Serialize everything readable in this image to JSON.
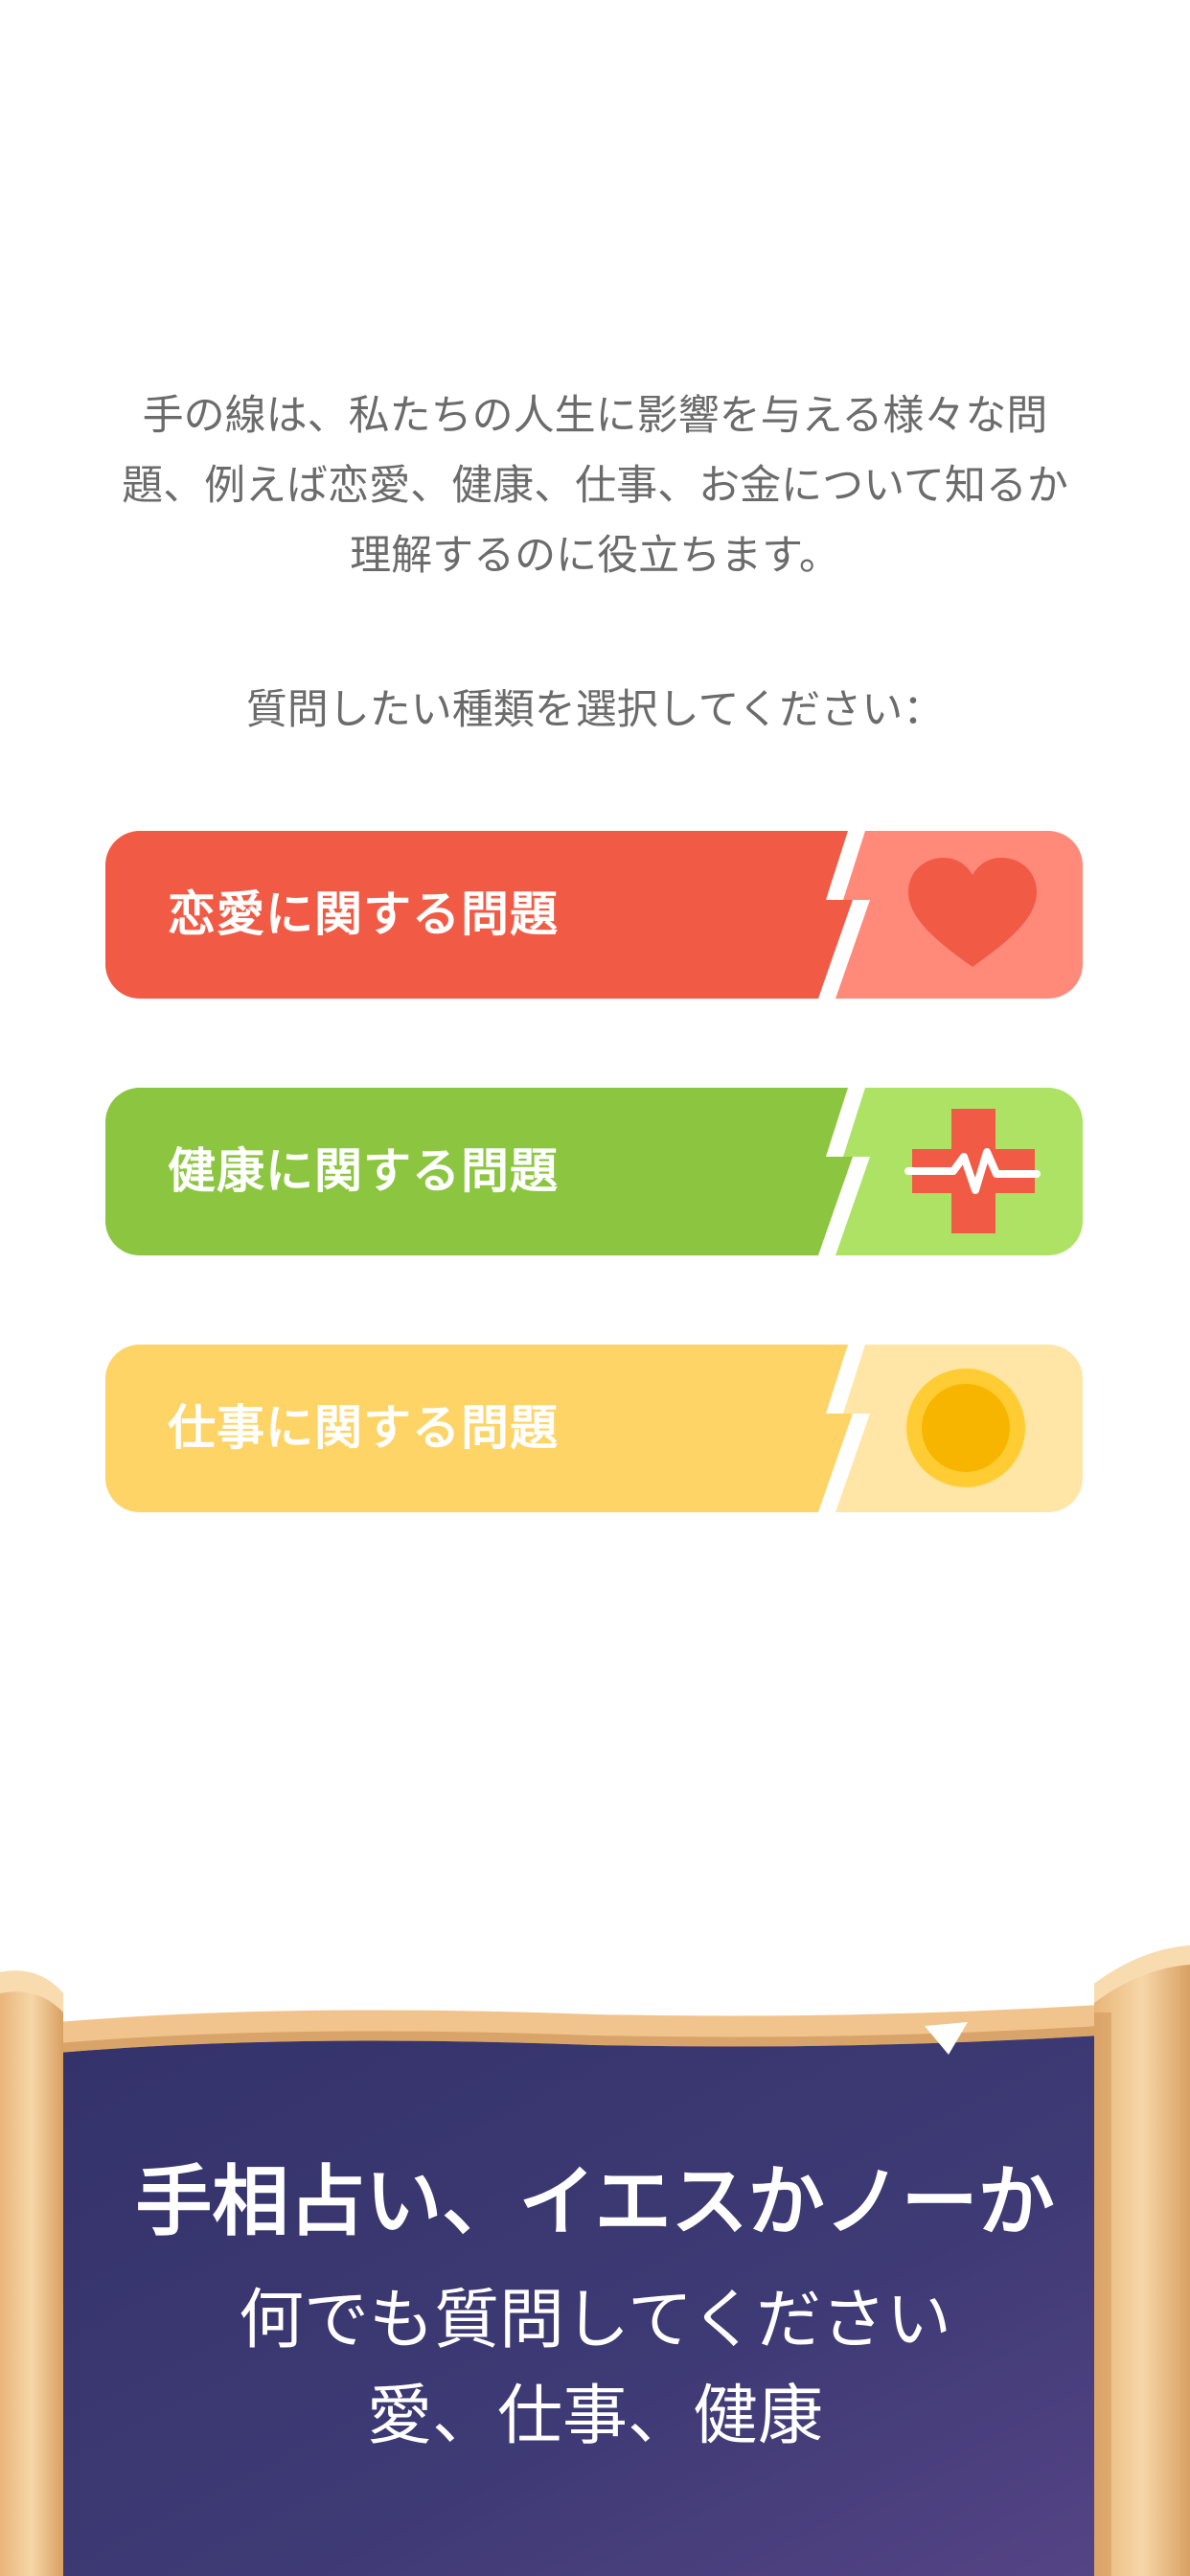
{
  "intro": {
    "line1": "手の線は、私たちの人生に影響を与える様々な問",
    "line2": "題、例えば恋愛、健康、仕事、お金について知るか",
    "line3": "理解するのに役立ちます。"
  },
  "prompt": "質問したい種類を選択してください：",
  "topics": [
    {
      "label": "恋愛に関する問題",
      "icon": "heart-icon",
      "main_color": "#f15b46",
      "side_color": "#ff8a7a",
      "icon_color": "#f15b46"
    },
    {
      "label": "健康に関する問題",
      "icon": "medical-cross-icon",
      "main_color": "#8cc640",
      "side_color": "#aee264",
      "icon_color": "#f15b46"
    },
    {
      "label": "仕事に関する問題",
      "icon": "coin-icon",
      "main_color": "#ffd466",
      "side_color": "#ffe6a6",
      "icon_color": "#f7b500"
    }
  ],
  "banner": {
    "title": "手相占い、イエスかノーか",
    "subtitle1": "何でも質問してください",
    "subtitle2": "愛、仕事、健康",
    "background_color": "#3e3a75",
    "scroll_color": "#f1c894"
  }
}
